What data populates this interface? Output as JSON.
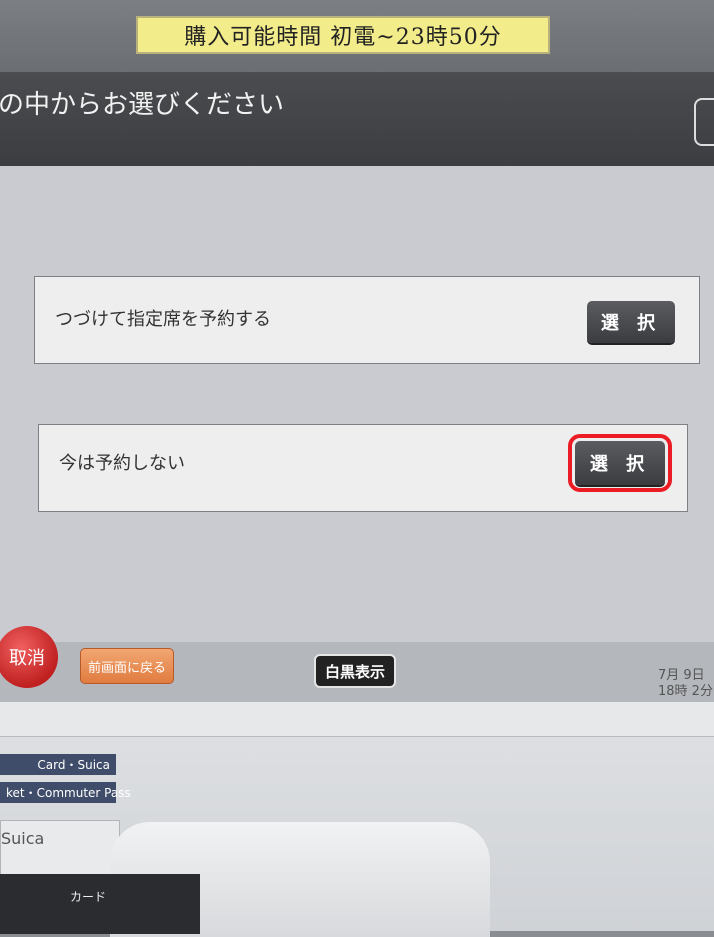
{
  "sign": {
    "hours": "購入可能時間 初電~23時50分"
  },
  "screen": {
    "title": "の中からお選びください",
    "options": [
      {
        "label": "つづけて指定席を予約する",
        "button": "選 択"
      },
      {
        "label": "今は予約しない",
        "button": "選 択"
      }
    ],
    "bottom": {
      "cancel": "取消",
      "back": "前画面に戻る",
      "monochrome": "白黒表示",
      "date": "7月 9日",
      "time": "18時 2分"
    }
  },
  "machine": {
    "tag1": "Card・Suica",
    "tag2": "ket・Commuter Pass",
    "reader": "Suica",
    "card": "カード"
  }
}
